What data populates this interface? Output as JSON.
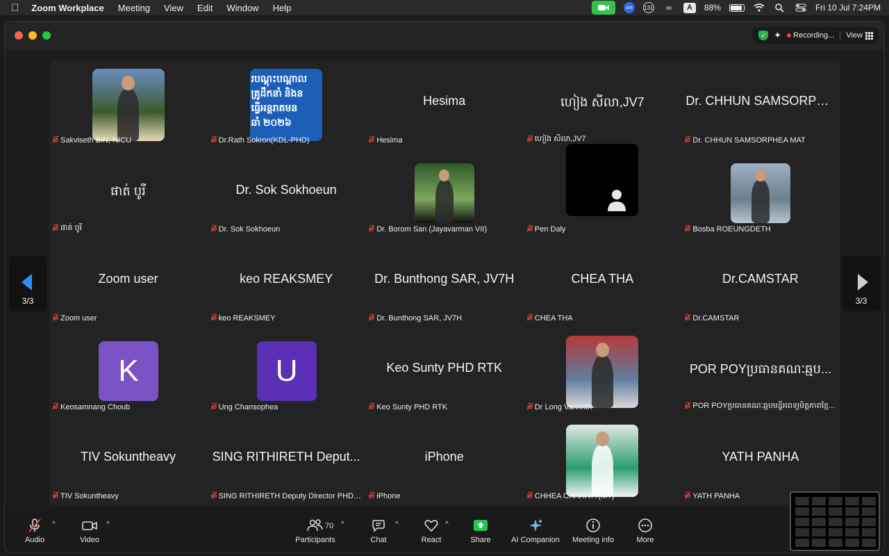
{
  "menubar": {
    "app_name": "Zoom Workplace",
    "menus": [
      "Meeting",
      "View",
      "Edit",
      "Window",
      "Help"
    ],
    "badge_count": "131",
    "input_source": "A",
    "battery": "88%",
    "battery_level": 0.88,
    "datetime": "Fri 10 Jul  7:24PM",
    "zoom_badge": "zm"
  },
  "topbar": {
    "recording": "Recording...",
    "view": "View"
  },
  "navigation": {
    "page_left": "3/3",
    "page_right": "3/3"
  },
  "participants": [
    {
      "display": "",
      "label": "Sakviseth BIN, NICU",
      "kind": "photo"
    },
    {
      "display": "",
      "label": "Dr.Rath Sokron(KDL-PHD)",
      "kind": "banner",
      "banner_lines": [
        "របណ្តុះបណ្តាល",
        "គ្រូដឹកនាំ និងន",
        "ធ្វើអន្តរាគមន",
        "ឆាំ ២០២៦"
      ]
    },
    {
      "display": "Hesima",
      "label": "Hesima",
      "kind": "name"
    },
    {
      "display": "ហៀង សីលា,JV7",
      "label": "ហៀង សីលា,JV7",
      "kind": "name"
    },
    {
      "display": "Dr. CHHUN SAMSORPH...",
      "label": "Dr. CHHUN SAMSORPHEA MAT",
      "kind": "name"
    },
    {
      "display": "ផាត់ បូរី",
      "label": "ផាត់ បូរី",
      "kind": "name"
    },
    {
      "display": "Dr. Sok Sokhoeun",
      "label": "Dr. Sok Sokhoeun",
      "kind": "name"
    },
    {
      "display": "",
      "label": "Dr. Borom San (Jayavarman VII)",
      "kind": "photo"
    },
    {
      "display": "",
      "label": "Pen Daly",
      "kind": "blank"
    },
    {
      "display": "",
      "label": "Bosba ROEUNGDETH",
      "kind": "photo"
    },
    {
      "display": "Zoom user",
      "label": "Zoom user",
      "kind": "name"
    },
    {
      "display": "keo REAKSMEY",
      "label": "keo REAKSMEY",
      "kind": "name"
    },
    {
      "display": "Dr. Bunthong SAR, JV7H",
      "label": "Dr. Bunthong SAR, JV7H",
      "kind": "name"
    },
    {
      "display": "CHEA THA",
      "label": "CHEA THA",
      "kind": "name"
    },
    {
      "display": "Dr.CAMSTAR",
      "label": "Dr.CAMSTAR",
      "kind": "name"
    },
    {
      "display": "K",
      "label": "Keosamnang Choub",
      "kind": "letter",
      "color": "#7b52c4"
    },
    {
      "display": "U",
      "label": "Ung Chansophea",
      "kind": "letter",
      "color": "#5b2fb6"
    },
    {
      "display": "Keo Sunty PHD RTK",
      "label": "Keo Sunty PHD RTK",
      "kind": "name"
    },
    {
      "display": "",
      "label": "Dr Long Vannrith",
      "kind": "photo"
    },
    {
      "display": "POR POYប្រធានគណៈឆ្មប...",
      "label": "POR POYប្រធានគណៈឆ្មបមន្ទីរពេទ្យមិត្តភាពខ្មែ...",
      "kind": "name"
    },
    {
      "display": "TIV Sokuntheavy",
      "label": "TIV Sokuntheavy",
      "kind": "name"
    },
    {
      "display": "SING RITHIRETH Deput...",
      "label": "SING RITHIRETH Deputy Director PHDSR",
      "kind": "name"
    },
    {
      "display": "iPhone",
      "label": "iPhone",
      "kind": "name"
    },
    {
      "display": "",
      "label": "CHHEA CHARIYA (MT)",
      "kind": "photo"
    },
    {
      "display": "YATH PANHA",
      "label": "YATH PANHA",
      "kind": "name"
    }
  ],
  "toolbar": {
    "audio": "Audio",
    "video": "Video",
    "participants": "Participants",
    "participants_count": "70",
    "chat": "Chat",
    "react": "React",
    "share": "Share",
    "ai_companion": "AI Companion",
    "meeting_info": "Meeting info",
    "more": "More"
  },
  "colors": {
    "accent_blue": "#2f8ef5",
    "share_green": "#23c552",
    "muted_red": "#e5463b"
  }
}
